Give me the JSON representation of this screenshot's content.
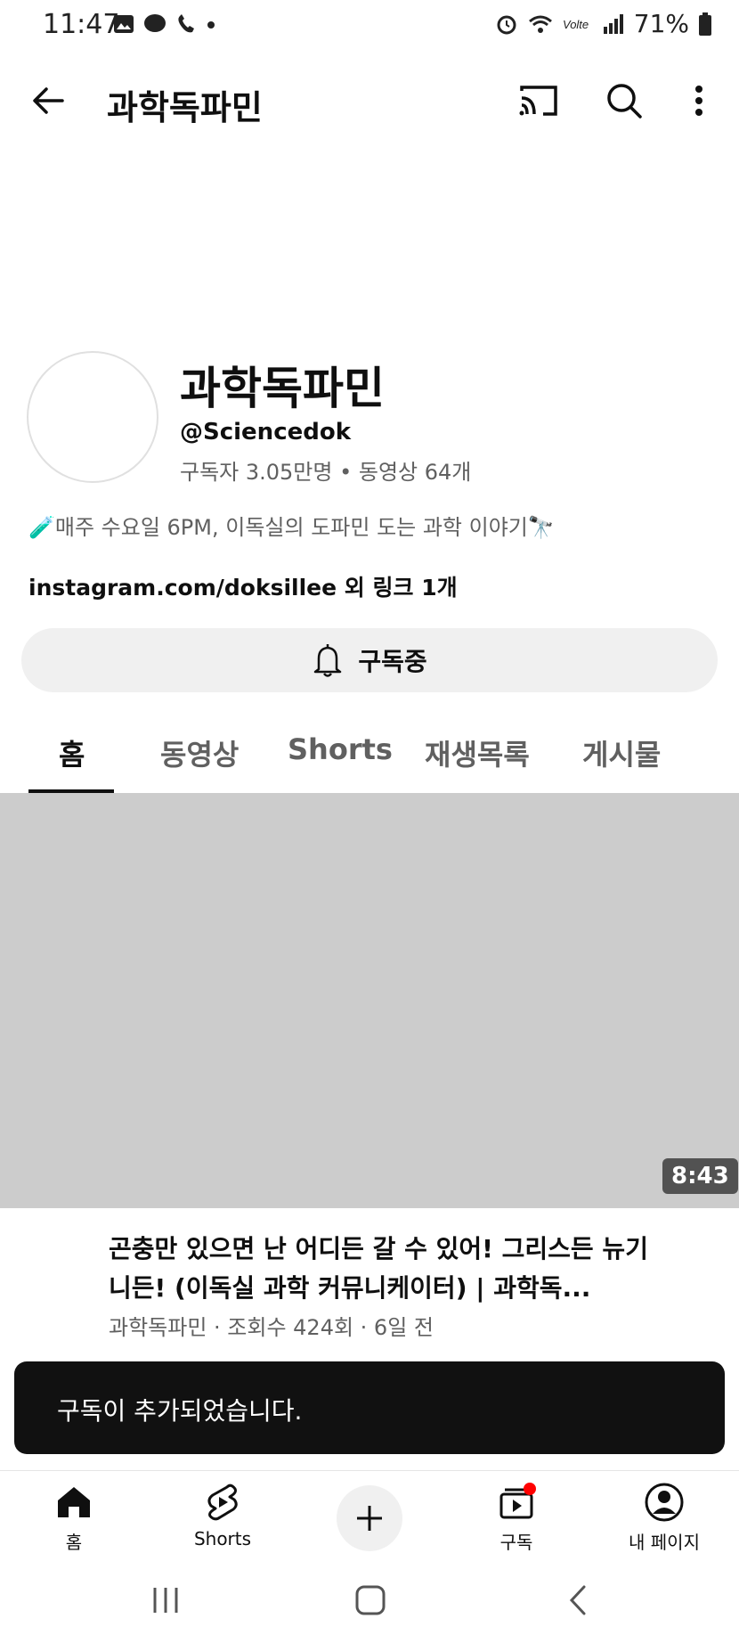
{
  "status_bar": {
    "time": "11:47",
    "battery": "71%"
  },
  "appbar": {
    "title": "과학독파민",
    "icons": [
      "back-arrow-icon",
      "cast-icon",
      "search-icon",
      "more-vert-icon"
    ]
  },
  "channel": {
    "name": "과학독파민",
    "handle": "@Sciencedok",
    "stats": "구독자 3.05만명 • 동영상 64개",
    "description": "🧪매주 수요일 6PM, 이독실의 도파민 도는 과학 이야기🔭",
    "link": "instagram.com/doksillee 외 링크 1개",
    "subscribe_label": "구독중"
  },
  "tabs": [
    {
      "label": "홈",
      "active": true
    },
    {
      "label": "동영상",
      "active": false
    },
    {
      "label": "Shorts",
      "active": false
    },
    {
      "label": "재생목록",
      "active": false
    },
    {
      "label": "게시물",
      "active": false
    }
  ],
  "video": {
    "duration": "8:43",
    "title": "곤충만 있으면 난 어디든 갈 수 있어! 그리스든 뉴기니든! (이독실 과학 커뮤니케이터) | 과학독...",
    "meta": "과학독파민 · 조회수 424회 · 6일 전"
  },
  "toast": {
    "message": "구독이 추가되었습니다."
  },
  "bottom_nav": {
    "home": "홈",
    "shorts": "Shorts",
    "subscriptions": "구독",
    "you": "내 페이지",
    "accent_color": "#ff0000"
  }
}
